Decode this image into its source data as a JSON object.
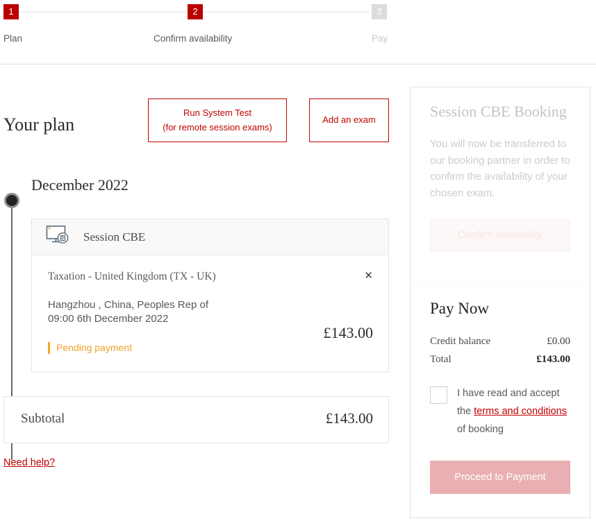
{
  "stepper": {
    "steps": [
      {
        "number": "1",
        "label": "Plan",
        "state": "active"
      },
      {
        "number": "2",
        "label": "Confirm availability",
        "state": "active"
      },
      {
        "number": "3",
        "label": "Pay",
        "state": "inactive"
      }
    ]
  },
  "plan": {
    "heading": "Your plan",
    "system_test_line1": "Run System Test",
    "system_test_line2": "(for remote session exams)",
    "add_exam_label": "Add an exam",
    "month": "December 2022",
    "need_help": "Need help?"
  },
  "card": {
    "type_label": "Session CBE",
    "type_icon": "monitor-document-icon",
    "exam_name": "Taxation - United Kingdom (TX - UK)",
    "location": "Hangzhou , China, Peoples Rep of",
    "datetime": "09:00 6th December 2022",
    "status": "Pending payment",
    "status_color": "#f0a028",
    "price": "£143.00",
    "remove_icon": "close-icon"
  },
  "subtotal": {
    "label": "Subtotal",
    "value": "£143.00"
  },
  "booking_panel": {
    "title": "Session CBE Booking",
    "description": "You will now be transferred to our booking partner in order to confirm the availability of your chosen exam.",
    "confirm_label": "Confirm availability"
  },
  "pay_panel": {
    "title": "Pay Now",
    "credit_label": "Credit balance",
    "credit_value": "£0.00",
    "total_label": "Total",
    "total_value": "£143.00",
    "terms_prefix": "I have read and accept the ",
    "terms_link": "terms and conditions",
    "terms_suffix": " of booking",
    "proceed_label": "Proceed to Payment"
  },
  "colors": {
    "brand_red": "#bb0000",
    "link_red": "#c00000",
    "warning_orange": "#f0a028",
    "disabled_pink": "#e9afb2",
    "step_inactive_grey": "#dcdcdc"
  }
}
